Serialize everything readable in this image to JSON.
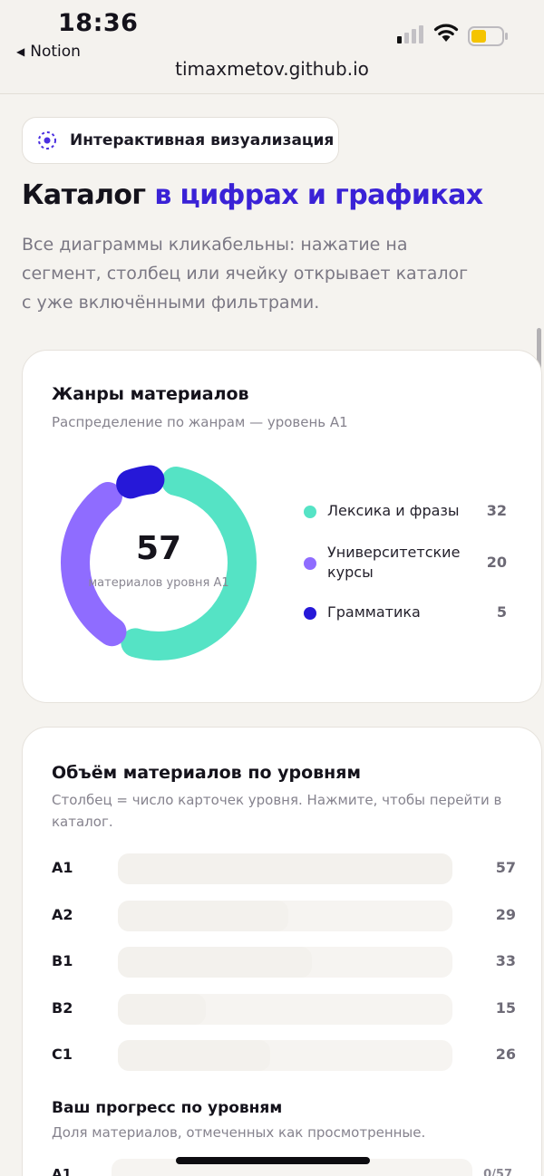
{
  "status_bar": {
    "time": "18:36",
    "back_app": "Notion",
    "url": "timaxmetov.github.io",
    "icons": [
      "cellular-signal-icon",
      "wifi-icon",
      "battery-icon"
    ],
    "battery_color": "#f5c400"
  },
  "header": {
    "badge": "Интерактивная визуализация",
    "title_plain": "Каталог",
    "title_accent": "в цифрах и графиках",
    "lead": "Все диаграммы кликабельны: нажатие на сегмент, столбец или ячейку открывает каталог с уже включёнными фильтрами."
  },
  "colors": {
    "accent": "#3a22d6",
    "teal": "#55e3c5",
    "violet": "#8f6cff",
    "indigo": "#2618d8"
  },
  "genres_card": {
    "title": "Жанры материалов",
    "subtitle": "Распределение по жанрам — уровень A1",
    "total": "57",
    "total_caption": "материалов уровня A1"
  },
  "levels_card": {
    "title": "Объём материалов по уровням",
    "subtitle": "Столбец = число карточек уровня. Нажмите, чтобы перейти в каталог.",
    "progress_title": "Ваш прогресс по уровням",
    "progress_subtitle": "Доля материалов, отмеченных как просмотренные.",
    "progress_first": {
      "level": "A1",
      "value": "0/57"
    }
  },
  "chart_data": [
    {
      "type": "pie",
      "title": "Жанры материалов",
      "subtitle": "Распределение по жанрам — уровень A1",
      "categories": [
        "Лексика и фразы",
        "Университетские курсы",
        "Грамматика"
      ],
      "values": [
        32,
        20,
        5
      ],
      "total": 57,
      "colors": [
        "#55e3c5",
        "#8f6cff",
        "#2618d8"
      ],
      "legend": "right"
    },
    {
      "type": "bar",
      "orientation": "horizontal",
      "title": "Объём материалов по уровням",
      "categories": [
        "A1",
        "A2",
        "B1",
        "B2",
        "C1"
      ],
      "values": [
        57,
        29,
        33,
        15,
        26
      ],
      "xlim": [
        0,
        57
      ]
    }
  ]
}
